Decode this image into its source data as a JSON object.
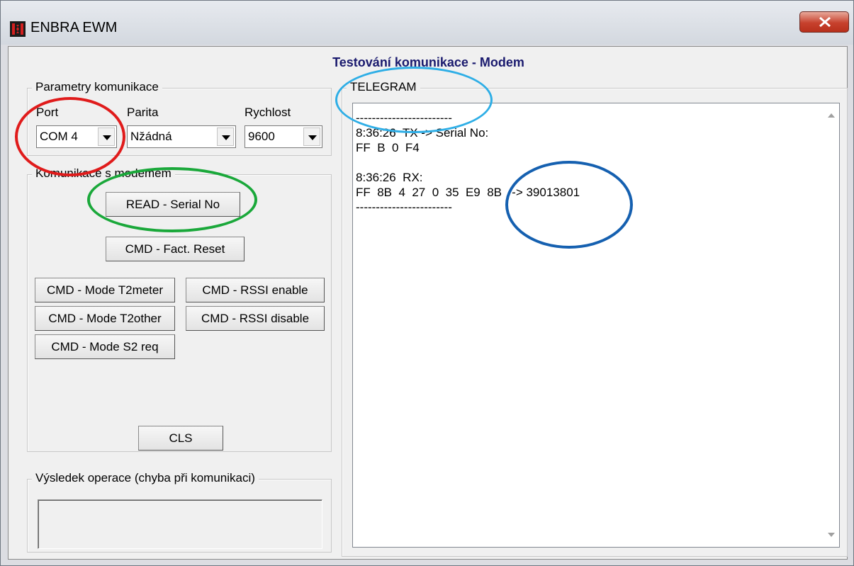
{
  "window": {
    "title": "ENBRA EWM",
    "close_label": "X"
  },
  "heading": "Testování komunikace - Modem",
  "params": {
    "legend": "Parametry komunikace",
    "port_label": "Port",
    "port_value": "COM 4",
    "parity_label": "Parita",
    "parity_value": "Nžádná",
    "speed_label": "Rychlost",
    "speed_value": "9600"
  },
  "modem": {
    "legend": "Komunikace s modemem",
    "read_serial": "READ - Serial No",
    "fact_reset": "CMD - Fact. Reset",
    "mode_t2meter": "CMD - Mode T2meter",
    "rssi_enable": "CMD - RSSI enable",
    "mode_t2other": "CMD - Mode T2other",
    "rssi_disable": "CMD - RSSI disable",
    "mode_s2req": "CMD - Mode S2 req",
    "cls": "CLS"
  },
  "result": {
    "legend": "Výsledek operace (chyba při komunikaci)"
  },
  "telegram": {
    "legend": "TELEGRAM",
    "lines": [
      "------------------------",
      "8:36:26  TX -> Serial No:",
      "FF  B  0  F4",
      "",
      "8:36:26  RX:",
      "FF  8B  4  27  0  35  E9  8B   -> 39013801",
      "------------------------"
    ]
  },
  "colors": {
    "heading": "#1a1a6e",
    "annotation_red": "#e01b1b",
    "annotation_green": "#1aa83a",
    "annotation_light_blue": "#2eaee6",
    "annotation_dark_blue": "#1560b0"
  }
}
